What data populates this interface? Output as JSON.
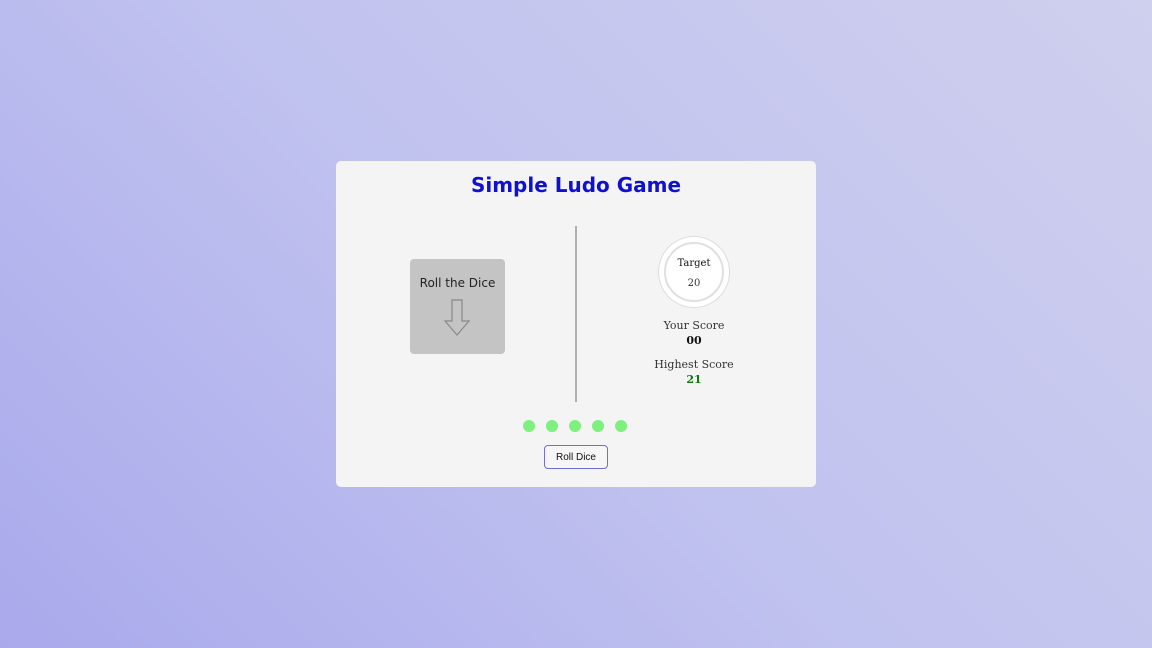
{
  "game": {
    "title": "Simple Ludo Game"
  },
  "dice": {
    "label": "Roll the Dice",
    "arrow_icon": "arrow-down-icon"
  },
  "target": {
    "label": "Target",
    "value": "20"
  },
  "scores": {
    "your_label": "Your Score",
    "your_value": "00",
    "highest_label": "Highest Score",
    "highest_value": "21"
  },
  "attempts": {
    "remaining": 5,
    "total": 5,
    "color": "#7ef07e"
  },
  "controls": {
    "roll_label": "Roll Dice"
  },
  "colors": {
    "title": "#1010d0",
    "highest_score": "#0a7a0a",
    "button_border": "#6f6fd8"
  }
}
